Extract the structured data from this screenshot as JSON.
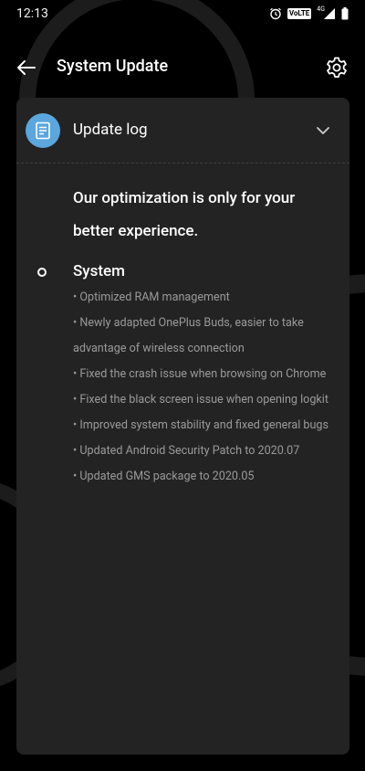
{
  "status_bar": {
    "time": "12:13",
    "volte": "VoLTE",
    "network": "4G"
  },
  "app_bar": {
    "title": "System Update"
  },
  "update_log": {
    "header_label": "Update log",
    "headline": "Our optimization is only for your better experience.",
    "section_title": "System",
    "items": [
      "• Optimized RAM management",
      "• Newly adapted OnePlus Buds, easier to take advantage of wireless connection",
      "• Fixed the crash issue when browsing on Chrome",
      "• Fixed the black screen issue when opening logkit",
      "• Improved system stability and fixed general bugs",
      "• Updated Android Security Patch to 2020.07",
      "• Updated GMS package to 2020.05"
    ]
  },
  "colors": {
    "background": "#000000",
    "card": "#232323",
    "accent_icon": "#5aa6dd",
    "secondary_text": "#9a9a9a"
  },
  "icons": [
    "alarm-icon",
    "signal-icon",
    "battery-icon",
    "back-arrow-icon",
    "gear-icon",
    "document-icon",
    "chevron-down-icon"
  ]
}
